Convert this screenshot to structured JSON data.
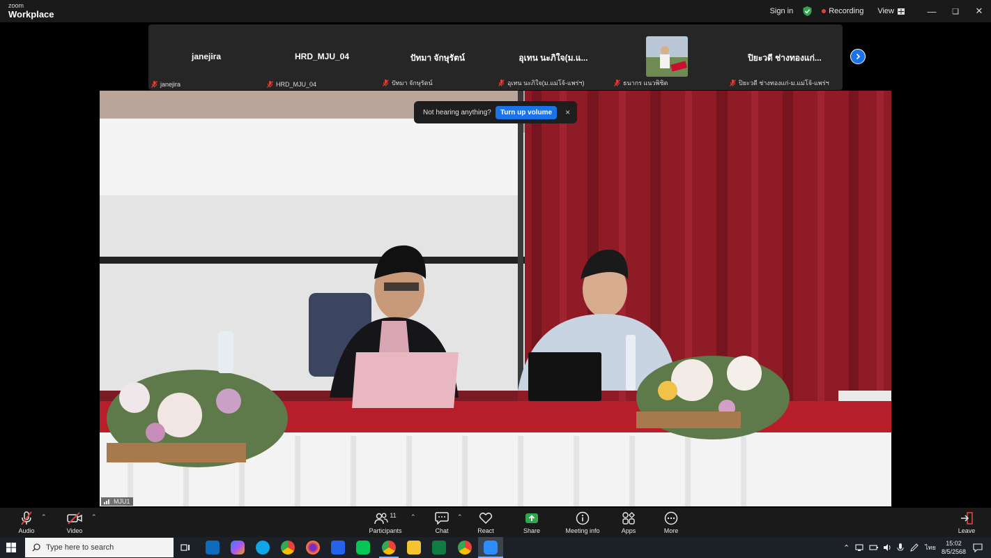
{
  "app": {
    "brand_small": "zoom",
    "brand_big": "Workplace"
  },
  "titlebar": {
    "sign_in": "Sign in",
    "recording": "Recording",
    "view": "View",
    "security_color": "#2ea84b",
    "recording_color": "#e0423a"
  },
  "participants_strip": [
    {
      "name": "janejira",
      "label": "janejira"
    },
    {
      "name": "HRD_MJU_04",
      "label": "HRD_MJU_04"
    },
    {
      "name": "ปัทมา  จักษุรัตน์",
      "label": "ปัทมา  จักษุรัตน์"
    },
    {
      "name": "อุเทน นะภิใจ(ม.แ...",
      "label": "อุเทน นะภิใจ(ม.แม่โจ้-แพร่ฯ)"
    },
    {
      "name": "",
      "label": "ธนากร แนวพิชิต",
      "has_avatar": true
    },
    {
      "name": "ปิยะวดี ช่างทองแก่...",
      "label": "ปิยะวดี ช่างทองแก่-ม.แม่โจ้-แพร่ฯ"
    }
  ],
  "main_video": {
    "label": "MJU1"
  },
  "toast": {
    "message": "Not hearing anything?",
    "button": "Turn up volume",
    "close": "×"
  },
  "toolbar": {
    "audio": "Audio",
    "video": "Video",
    "participants": "Participants",
    "participants_count": "11",
    "chat": "Chat",
    "react": "React",
    "share": "Share",
    "meeting_info": "Meeting info",
    "apps": "Apps",
    "more": "More",
    "leave": "Leave",
    "share_color": "#2ea84b",
    "leave_color": "#e0423a"
  },
  "taskbar": {
    "search_placeholder": "Type here to search",
    "language": "ไทย",
    "time": "15:02",
    "date": "8/5/2568"
  }
}
